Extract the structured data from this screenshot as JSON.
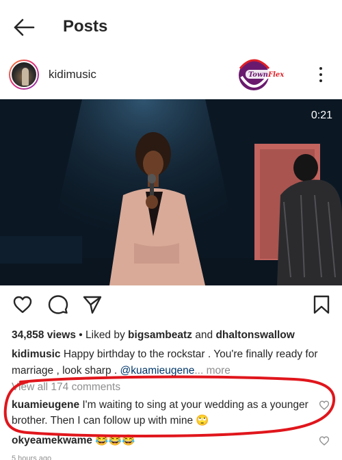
{
  "header": {
    "title": "Posts"
  },
  "post": {
    "username": "kidimusic",
    "watermark": "TownFlex",
    "video": {
      "duration": "0:21"
    },
    "views_count": "34,858 views",
    "liked_by_prefix": "• Liked by",
    "liked_by_user": "bigsambeatz",
    "liked_by_and": "and",
    "liked_by_other": "dhaltonswallow",
    "caption": {
      "user": "kidimusic",
      "text": "Happy birthday to the rockstar . You're finally ready for marriage , look sharp .",
      "mention": "@kuamieugene",
      "more": "... more"
    },
    "view_all_comments": "View all 174 comments",
    "comments": [
      {
        "user": "kuamieugene",
        "text": "I'm waiting to sing at your wedding as a younger brother. Then I can follow up with mine 🙄"
      },
      {
        "user": "okyeamekwame",
        "text": "😂😂😂"
      }
    ],
    "timestamp": "5 hours ago"
  },
  "colors": {
    "annotation": "#e0161c",
    "mention": "#00376b",
    "muted": "#8e8e8e"
  }
}
